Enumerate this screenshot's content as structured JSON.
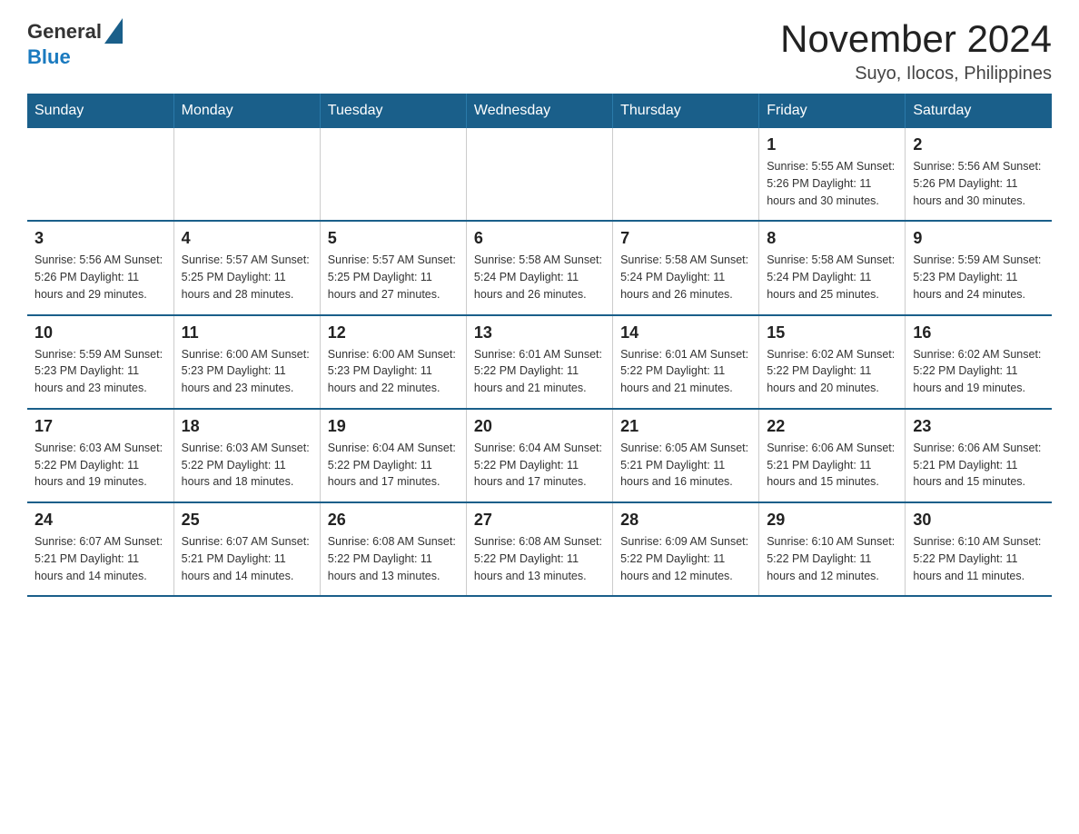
{
  "logo": {
    "general": "General",
    "blue": "Blue"
  },
  "title": "November 2024",
  "subtitle": "Suyo, Ilocos, Philippines",
  "days_of_week": [
    "Sunday",
    "Monday",
    "Tuesday",
    "Wednesday",
    "Thursday",
    "Friday",
    "Saturday"
  ],
  "weeks": [
    {
      "days": [
        {
          "number": "",
          "info": ""
        },
        {
          "number": "",
          "info": ""
        },
        {
          "number": "",
          "info": ""
        },
        {
          "number": "",
          "info": ""
        },
        {
          "number": "",
          "info": ""
        },
        {
          "number": "1",
          "info": "Sunrise: 5:55 AM\nSunset: 5:26 PM\nDaylight: 11 hours and 30 minutes."
        },
        {
          "number": "2",
          "info": "Sunrise: 5:56 AM\nSunset: 5:26 PM\nDaylight: 11 hours and 30 minutes."
        }
      ]
    },
    {
      "days": [
        {
          "number": "3",
          "info": "Sunrise: 5:56 AM\nSunset: 5:26 PM\nDaylight: 11 hours and 29 minutes."
        },
        {
          "number": "4",
          "info": "Sunrise: 5:57 AM\nSunset: 5:25 PM\nDaylight: 11 hours and 28 minutes."
        },
        {
          "number": "5",
          "info": "Sunrise: 5:57 AM\nSunset: 5:25 PM\nDaylight: 11 hours and 27 minutes."
        },
        {
          "number": "6",
          "info": "Sunrise: 5:58 AM\nSunset: 5:24 PM\nDaylight: 11 hours and 26 minutes."
        },
        {
          "number": "7",
          "info": "Sunrise: 5:58 AM\nSunset: 5:24 PM\nDaylight: 11 hours and 26 minutes."
        },
        {
          "number": "8",
          "info": "Sunrise: 5:58 AM\nSunset: 5:24 PM\nDaylight: 11 hours and 25 minutes."
        },
        {
          "number": "9",
          "info": "Sunrise: 5:59 AM\nSunset: 5:23 PM\nDaylight: 11 hours and 24 minutes."
        }
      ]
    },
    {
      "days": [
        {
          "number": "10",
          "info": "Sunrise: 5:59 AM\nSunset: 5:23 PM\nDaylight: 11 hours and 23 minutes."
        },
        {
          "number": "11",
          "info": "Sunrise: 6:00 AM\nSunset: 5:23 PM\nDaylight: 11 hours and 23 minutes."
        },
        {
          "number": "12",
          "info": "Sunrise: 6:00 AM\nSunset: 5:23 PM\nDaylight: 11 hours and 22 minutes."
        },
        {
          "number": "13",
          "info": "Sunrise: 6:01 AM\nSunset: 5:22 PM\nDaylight: 11 hours and 21 minutes."
        },
        {
          "number": "14",
          "info": "Sunrise: 6:01 AM\nSunset: 5:22 PM\nDaylight: 11 hours and 21 minutes."
        },
        {
          "number": "15",
          "info": "Sunrise: 6:02 AM\nSunset: 5:22 PM\nDaylight: 11 hours and 20 minutes."
        },
        {
          "number": "16",
          "info": "Sunrise: 6:02 AM\nSunset: 5:22 PM\nDaylight: 11 hours and 19 minutes."
        }
      ]
    },
    {
      "days": [
        {
          "number": "17",
          "info": "Sunrise: 6:03 AM\nSunset: 5:22 PM\nDaylight: 11 hours and 19 minutes."
        },
        {
          "number": "18",
          "info": "Sunrise: 6:03 AM\nSunset: 5:22 PM\nDaylight: 11 hours and 18 minutes."
        },
        {
          "number": "19",
          "info": "Sunrise: 6:04 AM\nSunset: 5:22 PM\nDaylight: 11 hours and 17 minutes."
        },
        {
          "number": "20",
          "info": "Sunrise: 6:04 AM\nSunset: 5:22 PM\nDaylight: 11 hours and 17 minutes."
        },
        {
          "number": "21",
          "info": "Sunrise: 6:05 AM\nSunset: 5:21 PM\nDaylight: 11 hours and 16 minutes."
        },
        {
          "number": "22",
          "info": "Sunrise: 6:06 AM\nSunset: 5:21 PM\nDaylight: 11 hours and 15 minutes."
        },
        {
          "number": "23",
          "info": "Sunrise: 6:06 AM\nSunset: 5:21 PM\nDaylight: 11 hours and 15 minutes."
        }
      ]
    },
    {
      "days": [
        {
          "number": "24",
          "info": "Sunrise: 6:07 AM\nSunset: 5:21 PM\nDaylight: 11 hours and 14 minutes."
        },
        {
          "number": "25",
          "info": "Sunrise: 6:07 AM\nSunset: 5:21 PM\nDaylight: 11 hours and 14 minutes."
        },
        {
          "number": "26",
          "info": "Sunrise: 6:08 AM\nSunset: 5:22 PM\nDaylight: 11 hours and 13 minutes."
        },
        {
          "number": "27",
          "info": "Sunrise: 6:08 AM\nSunset: 5:22 PM\nDaylight: 11 hours and 13 minutes."
        },
        {
          "number": "28",
          "info": "Sunrise: 6:09 AM\nSunset: 5:22 PM\nDaylight: 11 hours and 12 minutes."
        },
        {
          "number": "29",
          "info": "Sunrise: 6:10 AM\nSunset: 5:22 PM\nDaylight: 11 hours and 12 minutes."
        },
        {
          "number": "30",
          "info": "Sunrise: 6:10 AM\nSunset: 5:22 PM\nDaylight: 11 hours and 11 minutes."
        }
      ]
    }
  ]
}
